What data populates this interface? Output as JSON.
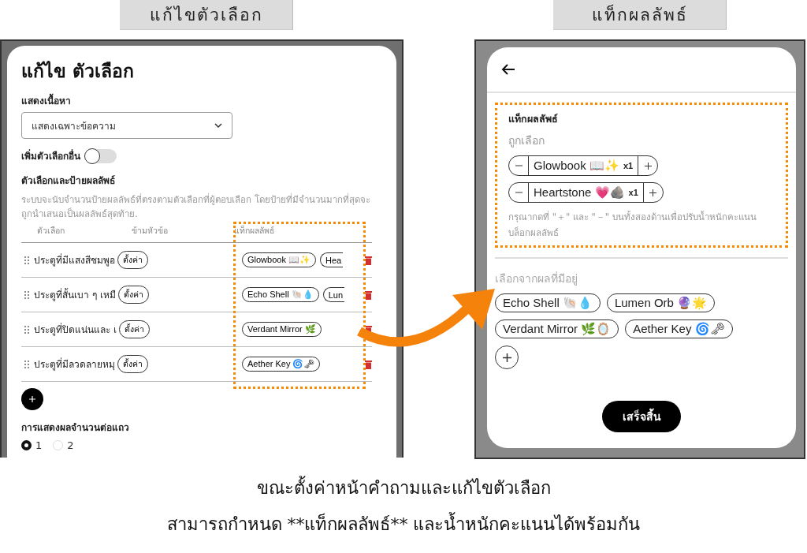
{
  "left_label": "แก้ไขตัวเลือก",
  "right_label": "แท็กผลลัพธ์",
  "edit_screen": {
    "title": "แก้ไข ตัวเลือก",
    "content_label": "แสดงเนื้อหา",
    "content_select": {
      "value": "แสดงเฉพาะข้อความ"
    },
    "more_options": {
      "label": "เพิ่มตัวเลือกอื่น",
      "on": false
    },
    "section_title": "ตัวเลือกและป้ายผลลัพธ์",
    "description": "ระบบจะนับจำนวนป้ายผลลัพธ์ที่ตรงตามตัวเลือกที่ผู้ตอบเลือก โดยป้ายที่มีจำนวนมากที่สุดจะถูกนำเสนอเป็นผลลัพธ์สุดท้าย.",
    "columns": [
      "ตัวเลือก",
      "ข้ามหัวข้อ",
      "แท็กผลลัพธ์"
    ],
    "rows": [
      {
        "option": "ประตูที่มีแสงสีชมพูอ",
        "settings_button": "ตั้งค่า",
        "tags": [
          {
            "label": "Glowbook 📖✨",
            "partial": false
          },
          {
            "label": "Hea",
            "partial": true
          }
        ]
      },
      {
        "option": "ประตูที่สั้นเบา ๆ เหมื",
        "settings_button": "ตั้งค่า",
        "tags": [
          {
            "label": "Echo Shell 🐚💧",
            "partial": false
          },
          {
            "label": "Lun",
            "partial": true
          }
        ]
      },
      {
        "option": "ประตูที่ปิดแน่นและ เ",
        "settings_button": "ตั้งค่า",
        "tags": [
          {
            "label": "Verdant Mirror 🌿",
            "partial": false
          }
        ]
      },
      {
        "option": "ประตูที่มีลวดลายหมุ",
        "settings_button": "ตั้งค่า",
        "tags": [
          {
            "label": "Aether Key 🌀🗝",
            "partial": false
          }
        ]
      }
    ],
    "per_row_label": "การแสดงผลจำนวนต่อแถว",
    "per_row_options": [
      {
        "label": "1",
        "selected": true
      },
      {
        "label": "2",
        "selected": false
      }
    ]
  },
  "tag_screen": {
    "section_title": "แท็กผลลัพธ์",
    "selected_label": "ถูกเลือก",
    "selected_tags": [
      {
        "label": "Glowbook 📖✨",
        "count": "x1"
      },
      {
        "label": "Heartstone 💗🪨",
        "count": "x1"
      }
    ],
    "hint": "กรุณากดที่ \"＋\" และ \"－\" บนทั้งสองด้านเพื่อปรับน้ำหนักคะแนนบล็อกผลลัพธ์",
    "available_label": "เลือกจากผลที่มีอยู่",
    "available_tags": [
      {
        "label": "Echo Shell 🐚💧"
      },
      {
        "label": "Lumen Orb 🔮🌟"
      },
      {
        "label": "Verdant Mirror 🌿🪞"
      },
      {
        "label": "Aether Key 🌀🗝"
      }
    ],
    "done_button": "เสร็จสิ้น"
  },
  "caption": [
    "ขณะตั้งค่าหน้าคำถามและแก้ไขตัวเลือก",
    "สามารถกำหนด **แท็กผลลัพธ์** และน้ำหนักคะแนนได้พร้อมกัน"
  ]
}
